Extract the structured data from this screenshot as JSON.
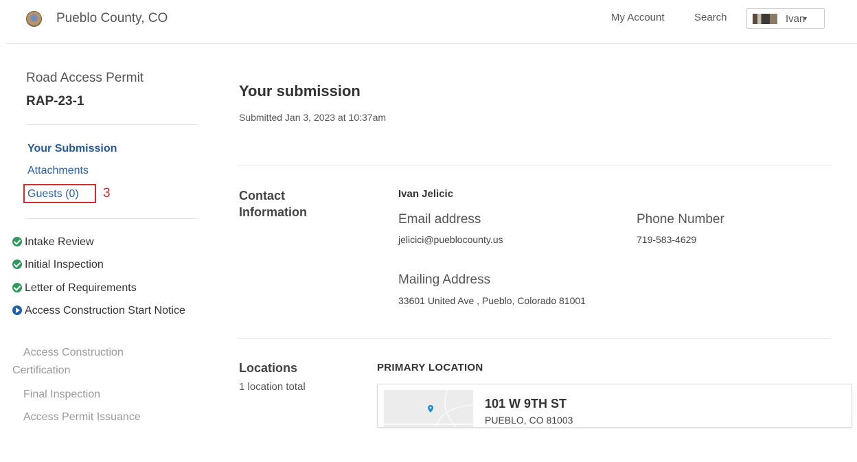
{
  "header": {
    "org_name": "Pueblo County, CO",
    "my_account": "My Account",
    "search": "Search",
    "user_name": "Ivan",
    "user_caret": "▾"
  },
  "sidebar": {
    "record_type": "Road Access Permit",
    "record_id": "RAP-23-1",
    "nav": [
      {
        "label": "Your Submission",
        "active": true
      },
      {
        "label": "Attachments"
      },
      {
        "label": "Guests (0)"
      }
    ],
    "annotation": "3",
    "steps": [
      {
        "label": "Intake Review",
        "status": "complete",
        "icon": "check-circle-icon"
      },
      {
        "label": "Initial Inspection",
        "status": "complete",
        "icon": "check-circle-icon"
      },
      {
        "label": "Letter of Requirements",
        "status": "complete",
        "icon": "check-circle-icon"
      },
      {
        "label": "Access Construction Start Notice",
        "status": "current",
        "icon": "play-circle-icon"
      },
      {
        "label": "Access Construction Certification",
        "status": "pending"
      },
      {
        "label": "Final Inspection",
        "status": "pending"
      },
      {
        "label": "Access Permit Issuance",
        "status": "pending"
      }
    ]
  },
  "main": {
    "title": "Your submission",
    "submitted": "Submitted Jan 3, 2023 at 10:37am",
    "contact": {
      "heading": "Contact Information",
      "name": "Ivan Jelicic",
      "email_label": "Email address",
      "email": "jelicici@pueblocounty.us",
      "phone_label": "Phone Number",
      "phone": "719-583-4629",
      "mailing_label": "Mailing Address",
      "mailing": "33601 United Ave , Pueblo, Colorado 81001"
    },
    "locations": {
      "heading": "Locations",
      "count": "1 location total",
      "primary_heading": "PRIMARY LOCATION",
      "street": "101 W 9TH ST",
      "city": "PUEBLO, CO 81003"
    }
  },
  "colors": {
    "link": "#2a62a8",
    "complete": "#2e9a5d",
    "current": "#1f5fa9",
    "annotation": "#d32a2a"
  }
}
